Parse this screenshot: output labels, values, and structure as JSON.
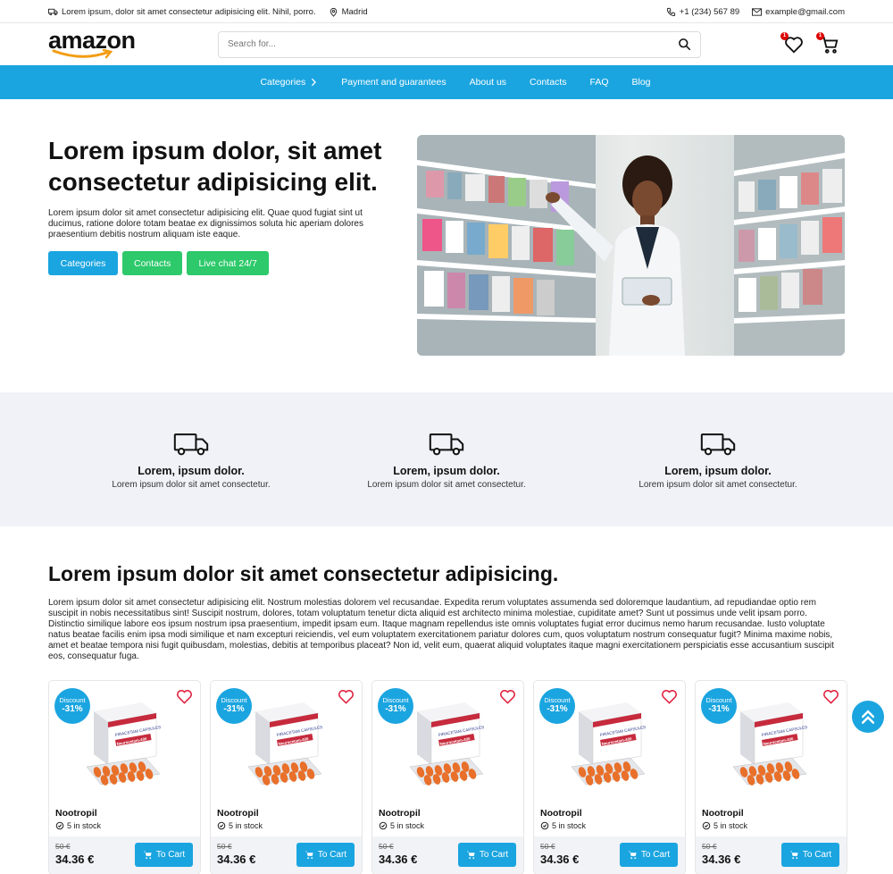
{
  "topbar": {
    "tagline": "Lorem ipsum, dolor sit amet consectetur adipisicing elit. Nihil, porro.",
    "city": "Madrid",
    "phone": "+1 (234) 567 89",
    "email": "example@gmail.com"
  },
  "header": {
    "logo_text": "amazon",
    "search_placeholder": "Search for...",
    "wishlist_count": "1",
    "cart_count": "1"
  },
  "nav": {
    "items": [
      "Categories",
      "Payment and guarantees",
      "About us",
      "Contacts",
      "FAQ",
      "Blog"
    ]
  },
  "hero": {
    "title": "Lorem ipsum dolor, sit amet consectetur adipisicing elit.",
    "text": "Lorem ipsum dolor sit amet consectetur adipisicing elit. Quae quod fugiat sint ut ducimus, ratione dolore totam beatae ex dignissimos soluta hic aperiam dolores praesentium debitis nostrum aliquam iste eaque.",
    "buttons": [
      "Categories",
      "Contacts",
      "Live chat 24/7"
    ]
  },
  "features": [
    {
      "title": "Lorem, ipsum dolor.",
      "text": "Lorem ipsum dolor sit amet consectetur."
    },
    {
      "title": "Lorem, ipsum dolor.",
      "text": "Lorem ipsum dolor sit amet consectetur."
    },
    {
      "title": "Lorem, ipsum dolor.",
      "text": "Lorem ipsum dolor sit amet consectetur."
    }
  ],
  "about": {
    "title": "Lorem ipsum dolor sit amet consectetur adipisicing.",
    "text": "Lorem ipsum dolor sit amet consectetur adipisicing elit. Nostrum molestias dolorem vel recusandae. Expedita rerum voluptates assumenda sed doloremque laudantium, ad repudiandae optio rem suscipit in nobis necessitatibus sint! Suscipit nostrum, dolores, totam voluptatum tenetur dicta aliquid est architecto minima molestiae, cupiditate amet? Sunt ut possimus unde velit ipsam porro. Distinctio similique labore eos ipsum nostrum ipsa praesentium, impedit ipsam eum. Itaque magnam repellendus iste omnis voluptates fugiat error ducimus nemo harum recusandae. Iusto voluptate natus beatae facilis enim ipsa modi similique et nam excepturi reiciendis, vel eum voluptatem exercitationem pariatur dolores cum, quos voluptatum nostrum consequatur fugit? Minima maxime nobis, amet et beatae tempora nisi fugit quibusdam, molestias, debitis at temporibus placeat? Non id, velit eum, quaerat aliquid voluptates itaque magni exercitationem perspiciatis esse accusantium suscipit eos, consequatur fuga."
  },
  "products": [
    {
      "discount_label": "Discount",
      "discount_value": "-31%",
      "name": "Nootropil",
      "stock": "5 in stock",
      "old_price": "50 €",
      "price": "34.36 €",
      "cart_label": "To Cart",
      "pack_title": "PIRACETAM CAPSULES",
      "pack_brand": "Neurocetam-400"
    },
    {
      "discount_label": "Discount",
      "discount_value": "-31%",
      "name": "Nootropil",
      "stock": "5 in stock",
      "old_price": "50 €",
      "price": "34.36 €",
      "cart_label": "To Cart",
      "pack_title": "PIRACETAM CAPSULES",
      "pack_brand": "Neurocetam-400"
    },
    {
      "discount_label": "Discount",
      "discount_value": "-31%",
      "name": "Nootropil",
      "stock": "5 in stock",
      "old_price": "50 €",
      "price": "34.36 €",
      "cart_label": "To Cart",
      "pack_title": "PIRACETAM CAPSULES",
      "pack_brand": "Neurocetam-400"
    },
    {
      "discount_label": "Discount",
      "discount_value": "-31%",
      "name": "Nootropil",
      "stock": "5 in stock",
      "old_price": "50 €",
      "price": "34.36 €",
      "cart_label": "To Cart",
      "pack_title": "PIRACETAM CAPSULES",
      "pack_brand": "Neurocetam-400"
    },
    {
      "discount_label": "Discount",
      "discount_value": "-31%",
      "name": "Nootropil",
      "stock": "5 in stock",
      "old_price": "50 €",
      "price": "34.36 €",
      "cart_label": "To Cart",
      "pack_title": "PIRACETAM CAPSULES",
      "pack_brand": "Neurocetam-400"
    }
  ],
  "icons": {
    "topbar": [
      "truck-icon",
      "map-pin-icon",
      "phone-icon",
      "mail-icon"
    ],
    "header": [
      "search-icon",
      "heart-icon",
      "cart-icon"
    ],
    "scroll_top": "double-chevron-up-icon"
  },
  "colors": {
    "accent": "#1ba5e0",
    "green": "#2dc96a",
    "badge": "#dd0000",
    "feature_bg": "#f0f2f7",
    "heart": "#e01e3c"
  }
}
